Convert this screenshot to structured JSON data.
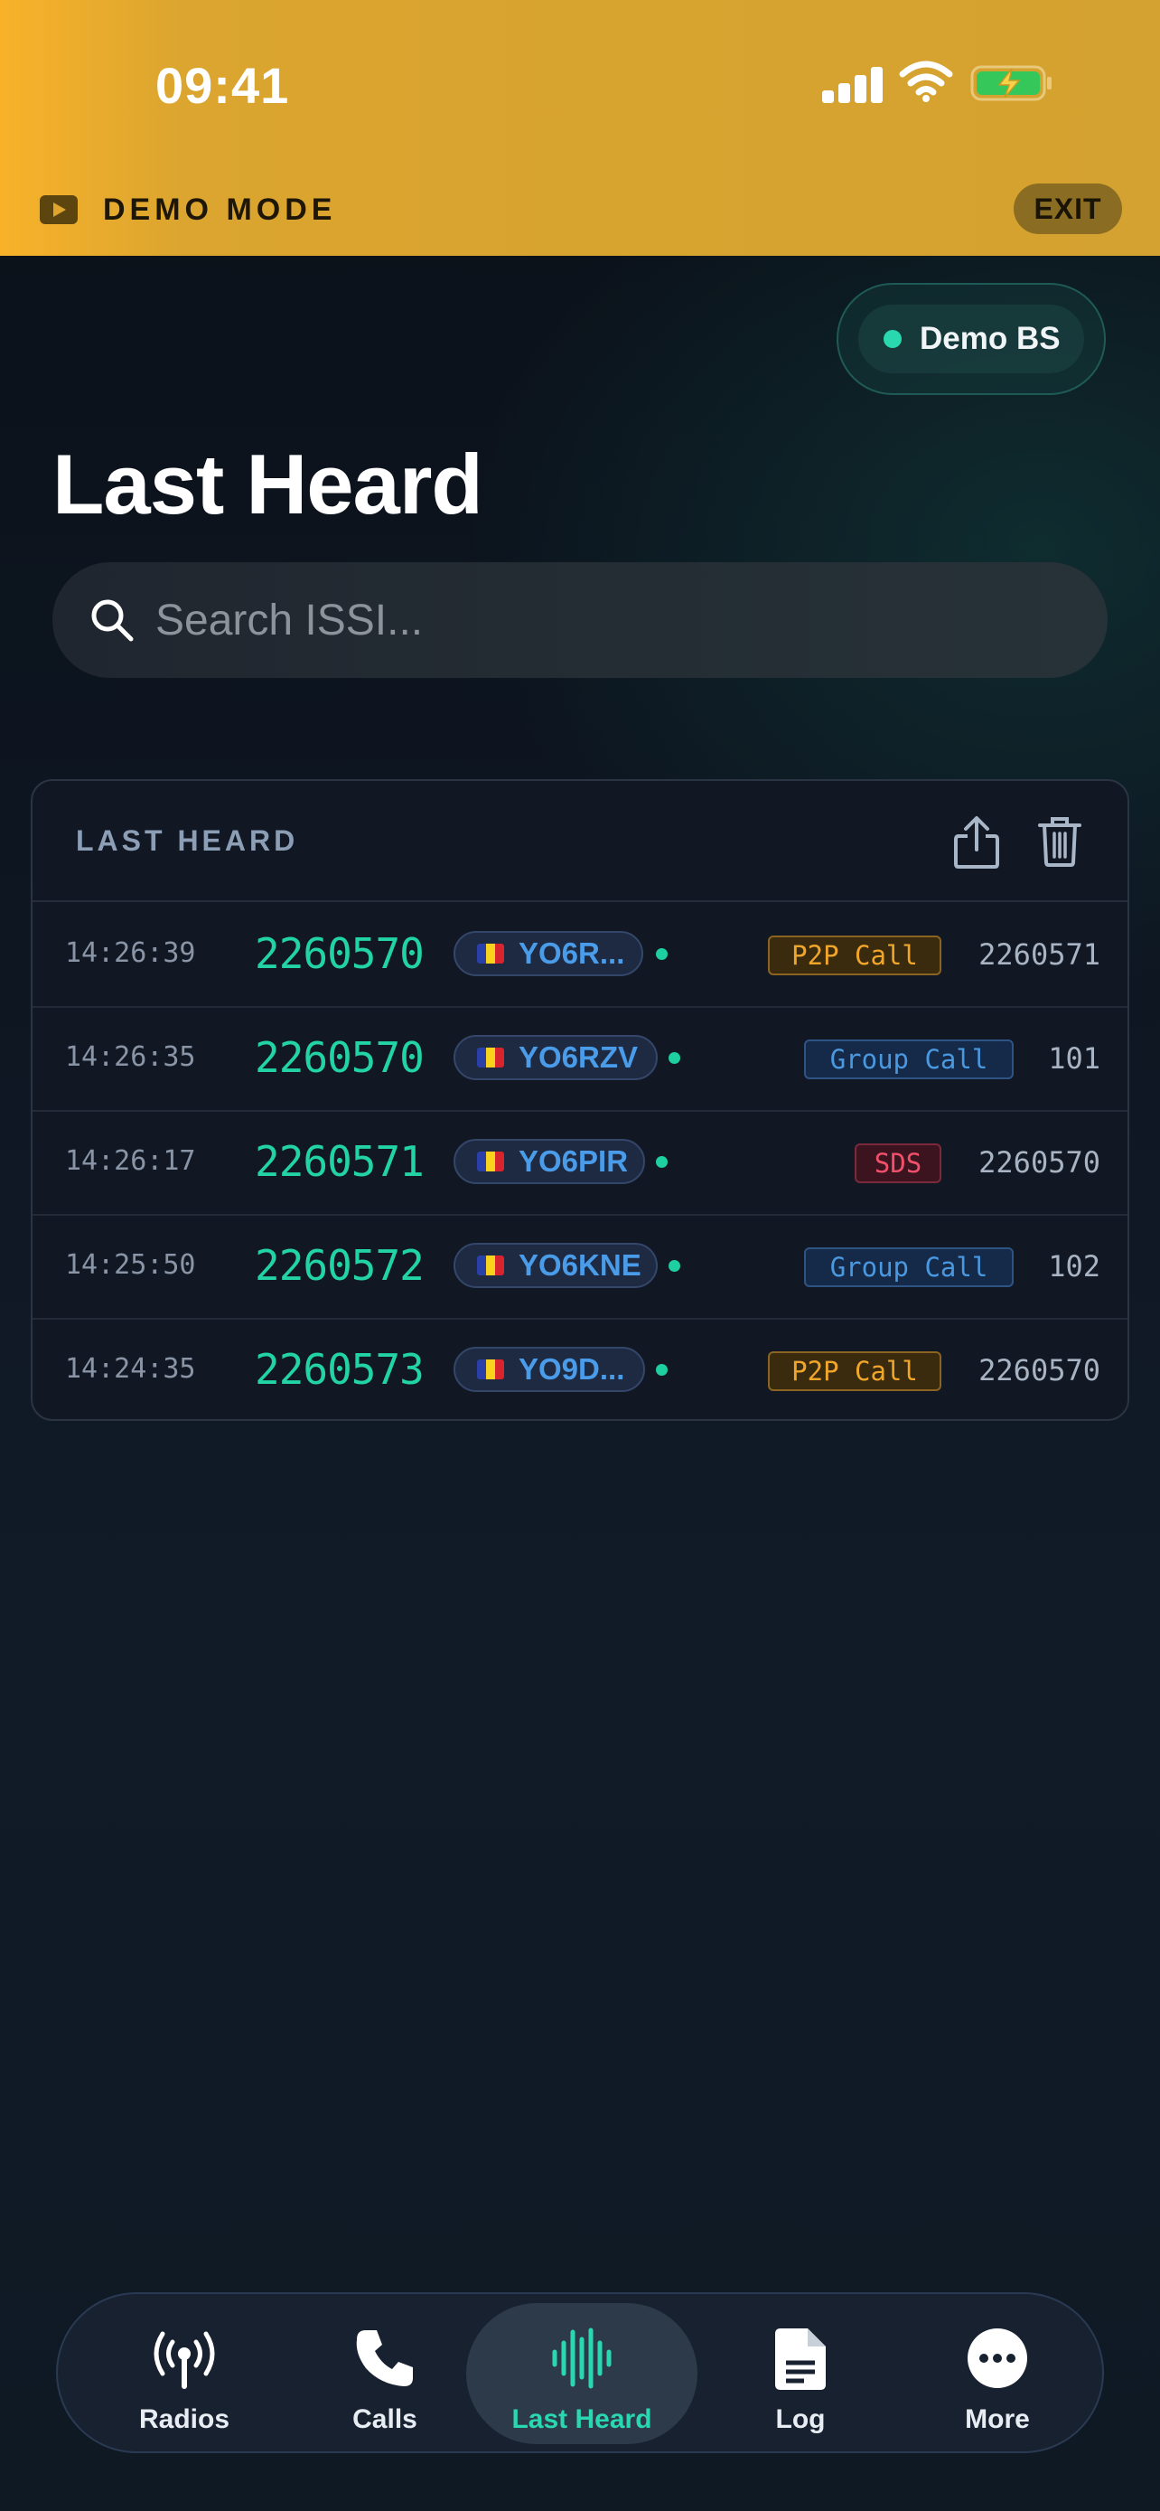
{
  "status_bar": {
    "time": "09:41"
  },
  "demo_banner": {
    "label": "DEMO MODE",
    "exit_label": "EXIT"
  },
  "base_station": {
    "label": "Demo BS",
    "status_color": "#2ad8b0"
  },
  "page_title": "Last Heard",
  "search": {
    "placeholder": "Search ISSI..."
  },
  "card": {
    "title": "LAST HEARD",
    "actions": [
      "share-icon",
      "trash-icon"
    ],
    "rows": [
      {
        "time": "14:26:39",
        "issi": "2260570",
        "callsign": "YO6R...",
        "call_type": "P2P Call",
        "destination": "2260571"
      },
      {
        "time": "14:26:35",
        "issi": "2260570",
        "callsign": "YO6RZV",
        "call_type": "Group Call",
        "destination": "101"
      },
      {
        "time": "14:26:17",
        "issi": "2260571",
        "callsign": "YO6PIR",
        "call_type": "SDS",
        "destination": "2260570"
      },
      {
        "time": "14:25:50",
        "issi": "2260572",
        "callsign": "YO6KNE",
        "call_type": "Group Call",
        "destination": "102"
      },
      {
        "time": "14:24:35",
        "issi": "2260573",
        "callsign": "YO9D...",
        "call_type": "P2P Call",
        "destination": "2260570"
      }
    ]
  },
  "tabs": [
    {
      "label": "Radios",
      "icon": "antenna-icon"
    },
    {
      "label": "Calls",
      "icon": "phone-icon"
    },
    {
      "label": "Last Heard",
      "icon": "waveform-icon",
      "active": true
    },
    {
      "label": "Log",
      "icon": "document-icon"
    },
    {
      "label": "More",
      "icon": "more-icon"
    }
  ],
  "colors": {
    "banner": "#dba52f",
    "accent": "#2ad8b0",
    "issi": "#22d3a4",
    "callsign": "#4a9be8",
    "p2p": "#f0a62a",
    "group": "#4a98e0",
    "sds": "#f0506a"
  }
}
